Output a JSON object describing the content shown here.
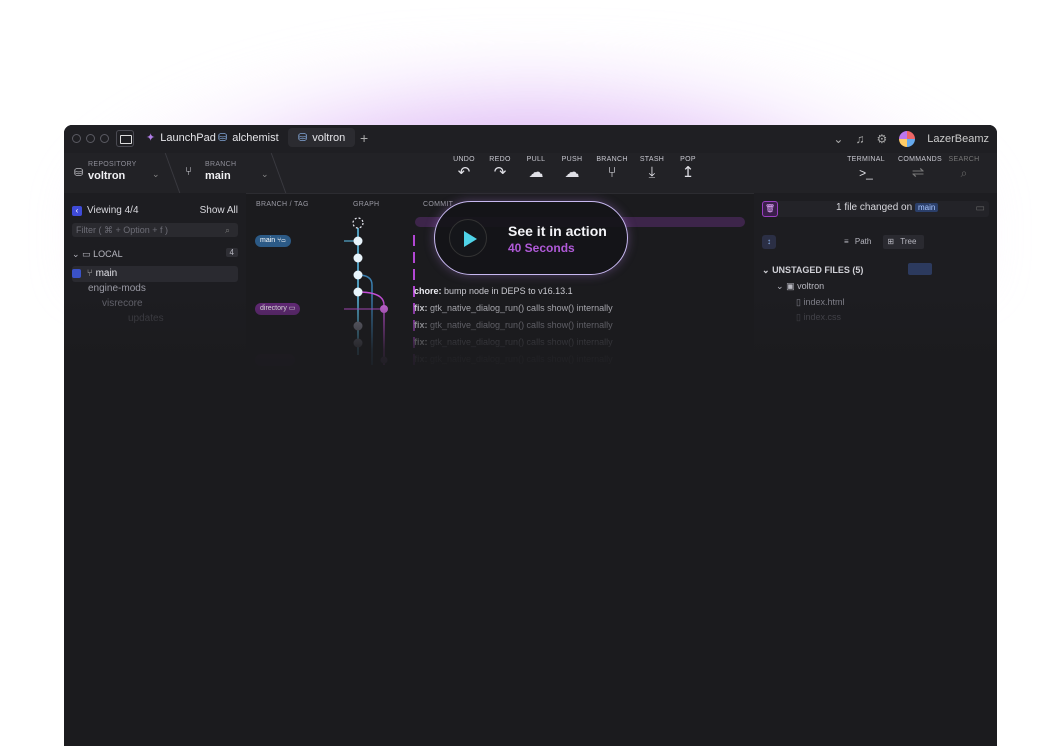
{
  "titlebar": {
    "tabs": [
      {
        "label": "LaunchPad"
      },
      {
        "label": "alchemist"
      },
      {
        "label": "voltron"
      }
    ],
    "user": "LazerBeamz"
  },
  "toolbar": {
    "repository_label": "REPOSITORY",
    "repository_value": "voltron",
    "branch_label": "BRANCH",
    "branch_value": "main",
    "actions": [
      "UNDO",
      "REDO",
      "PULL",
      "PUSH",
      "BRANCH",
      "STASH",
      "POP"
    ],
    "right_actions": [
      "TERMINAL",
      "COMMANDS",
      "SEARCH"
    ]
  },
  "left_panel": {
    "viewing": "Viewing 4/4",
    "show_all": "Show All",
    "filter_placeholder": "Filter ( ⌘ + Option + f )",
    "local_label": "LOCAL",
    "local_count": "4",
    "branches": [
      "main",
      "engine-mods",
      "visrecore",
      "updates"
    ]
  },
  "columns": {
    "branch_tag": "BRANCH / TAG",
    "graph": "GRAPH",
    "commit": "COMMIT"
  },
  "refs": {
    "main": "main",
    "directory": "directory"
  },
  "commits": [
    {
      "prefix": "chore:",
      "text": " bump node in DEPS to v16.13.1"
    },
    {
      "prefix": "fix:",
      "text": " gtk_native_dialog_run() calls show() internally"
    },
    {
      "prefix": "fix:",
      "text": " gtk_native_dialog_run() calls show() internally"
    },
    {
      "prefix": "fix:",
      "text": " gtk_native_dialog_run() calls show() internally"
    },
    {
      "prefix": "fix:",
      "text": " gtk_native_dialog_run() calls show() internally"
    }
  ],
  "right_panel": {
    "files_changed": "1 file changed on",
    "branch": "main",
    "path_label": "Path",
    "tree_label": "Tree",
    "unstaged": "UNSTAGED FILES (5)",
    "folder": "voltron",
    "files": [
      "index.html",
      "index.css"
    ]
  },
  "video_overlay": {
    "title": "See it in action",
    "subtitle": "40 Seconds"
  },
  "colors": {
    "accent_purple": "#b347d4",
    "accent_blue": "#5fc6f0",
    "glow": "#c478eb"
  }
}
